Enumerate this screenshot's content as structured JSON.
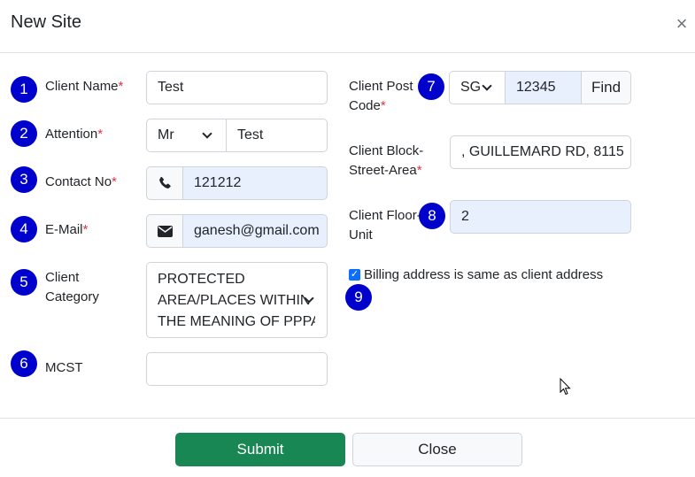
{
  "header": {
    "title": "New Site",
    "close_glyph": "×"
  },
  "badges": [
    "1",
    "2",
    "3",
    "4",
    "5",
    "6",
    "7",
    "8",
    "9"
  ],
  "required_mark": "*",
  "left": {
    "client_name": {
      "label": "Client Name",
      "value": "Test"
    },
    "attention": {
      "label": "Attention",
      "title_value": "Mr",
      "name_value": "Test"
    },
    "contact_no": {
      "label": "Contact No",
      "value": "121212",
      "icon": "phone-icon"
    },
    "email": {
      "label": "E-Mail",
      "value": "ganesh@gmail.com",
      "icon": "envelope-icon"
    },
    "client_category": {
      "label_line1": "Client",
      "label_line2": "Category",
      "value_lines": [
        "PROTECTED",
        "AREA/PLACES WITHIN",
        "THE MEANING OF PPPA"
      ]
    },
    "mcst": {
      "label": "MCST",
      "value": ""
    }
  },
  "right": {
    "post_code": {
      "label_line1": "Client Post",
      "label_line2": "Code",
      "country": "SG",
      "value": "12345",
      "find_label": "Find"
    },
    "block_street": {
      "label_line1": "Client Block-",
      "label_line2": "Street-Area",
      "value": ", GUILLEMARD RD, 8115"
    },
    "floor_unit": {
      "label_line1": "Client Floor-",
      "label_line2": "Unit",
      "value": "2"
    },
    "billing": {
      "label": "Billing address is same as client address",
      "checked": true
    }
  },
  "footer": {
    "submit_label": "Submit",
    "close_label": "Close"
  },
  "colors": {
    "badge": "#0000cc",
    "submit": "#198754",
    "required": "#dc3545",
    "autofill": "#e8f0fe"
  }
}
